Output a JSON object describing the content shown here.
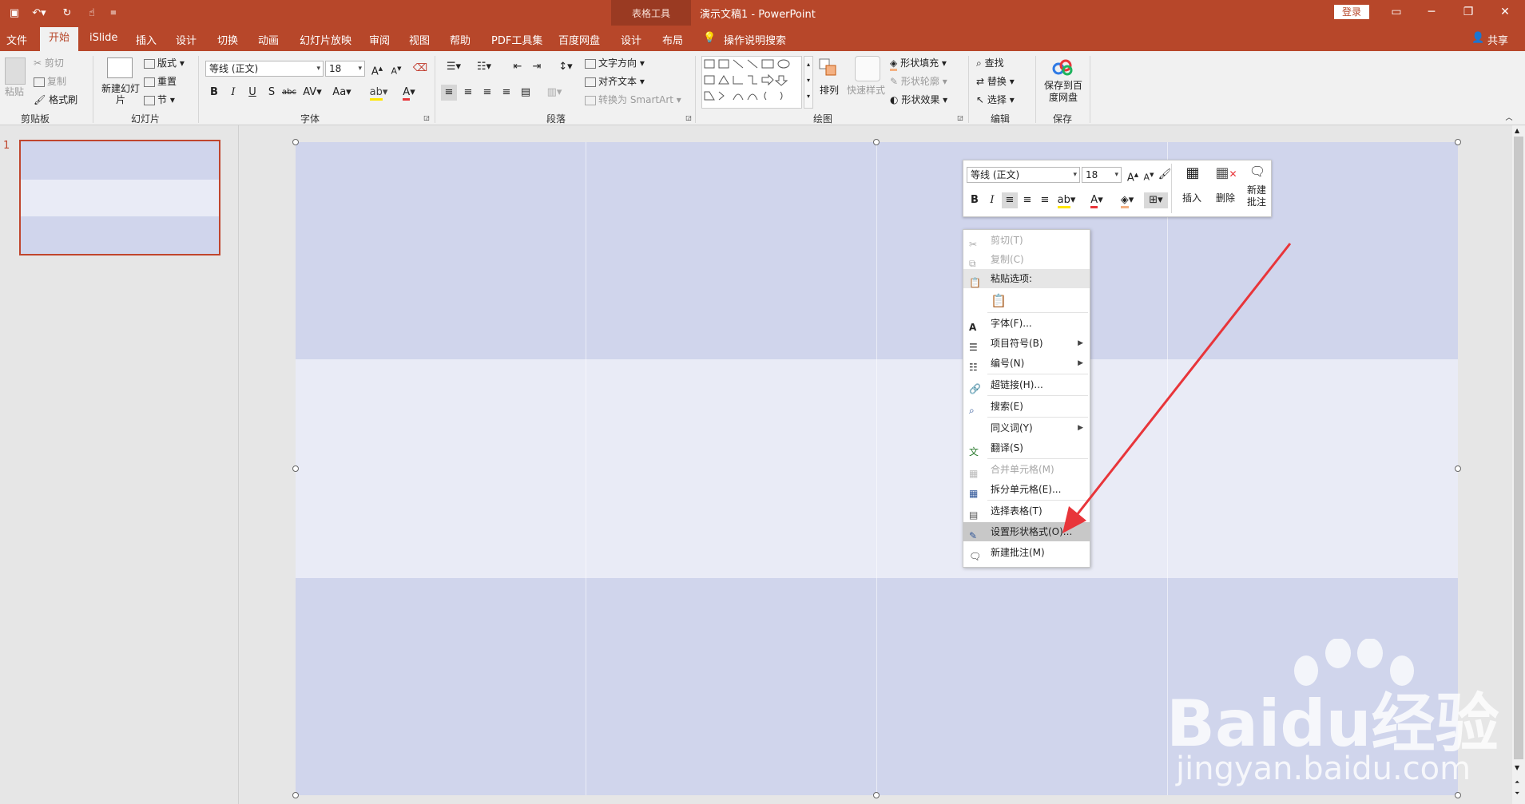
{
  "titlebar": {
    "context_tab": "表格工具",
    "document_title": "演示文稿1  -  PowerPoint",
    "login_button": "登录",
    "quick_access": [
      "save-icon",
      "undo-icon",
      "redo-icon",
      "touch-mode-icon",
      "customize-icon"
    ]
  },
  "tabs": [
    "文件",
    "开始",
    "iSlide",
    "插入",
    "设计",
    "切换",
    "动画",
    "幻灯片放映",
    "审阅",
    "视图",
    "帮助",
    "PDF工具集",
    "百度网盘",
    "设计",
    "布局"
  ],
  "tell_me": "操作说明搜索",
  "share": "共享",
  "ribbon": {
    "clipboard": {
      "label": "剪贴板",
      "paste": "粘贴",
      "cut": "剪切",
      "copy": "复制",
      "format_painter": "格式刷"
    },
    "slides": {
      "label": "幻灯片",
      "new_slide": "新建幻灯片",
      "layout": "版式",
      "reset": "重置",
      "section": "节"
    },
    "font": {
      "label": "字体",
      "font_name": "等线 (正文)",
      "font_size": "18"
    },
    "paragraph": {
      "label": "段落",
      "text_direction": "文字方向",
      "align_text": "对齐文本",
      "smartart": "转换为 SmartArt"
    },
    "drawing": {
      "label": "绘图",
      "arrange": "排列",
      "quick_styles": "快速样式",
      "shape_fill": "形状填充",
      "shape_outline": "形状轮廓",
      "shape_effect": "形状效果"
    },
    "editing": {
      "label": "编辑",
      "find": "查找",
      "replace": "替换",
      "select": "选择"
    },
    "save": {
      "label": "保存",
      "save_to_baidu": "保存到百度网盘"
    }
  },
  "slide_pane": {
    "slide_number": "1"
  },
  "mini_toolbar": {
    "font_name": "等线 (正文)",
    "font_size": "18",
    "insert": "插入",
    "delete": "删除",
    "new_comment": "新建批注"
  },
  "context_menu": {
    "cut": "剪切(T)",
    "copy": "复制(C)",
    "paste_options": "粘贴选项:",
    "font": "字体(F)...",
    "bullets": "项目符号(B)",
    "numbering": "编号(N)",
    "hyperlink": "超链接(H)...",
    "search": "搜索(E)",
    "synonyms": "同义词(Y)",
    "translate": "翻译(S)",
    "merge_cells": "合并单元格(M)",
    "split_cells": "拆分单元格(E)...",
    "select_table": "选择表格(T)",
    "format_shape": "设置形状格式(O)...",
    "new_comment": "新建批注(M)"
  },
  "watermark": {
    "brand": "Baidu",
    "brand_cn": "经验",
    "url": "jingyan.baidu.com"
  },
  "colors": {
    "accent": "#b7472a",
    "slide_dark": "#d0d5ec",
    "slide_light": "#e9ebf6",
    "arrow": "#e8353a"
  }
}
